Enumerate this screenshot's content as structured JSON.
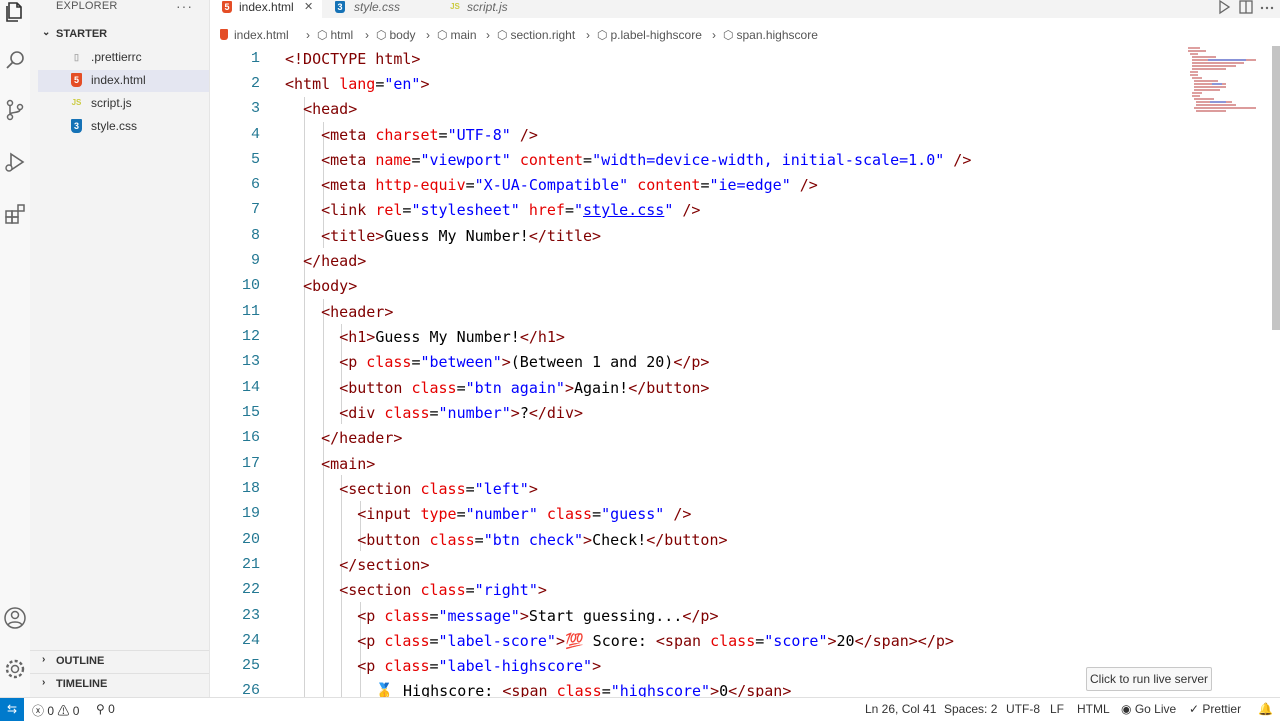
{
  "sidebar": {
    "title": "EXPLORER",
    "more": "···",
    "folder": "STARTER",
    "files": [
      {
        "name": ".prettierrc",
        "icon": "settings-file-icon"
      },
      {
        "name": "index.html",
        "icon": "html5-file-icon",
        "badge": "5"
      },
      {
        "name": "script.js",
        "icon": "javascript-file-icon",
        "badge": "JS"
      },
      {
        "name": "style.css",
        "icon": "css3-file-icon",
        "badge": "3"
      }
    ],
    "outline": "OUTLINE",
    "timeline": "TIMELINE"
  },
  "tabs": [
    {
      "label": "index.html",
      "active": true,
      "close": "✕",
      "badge": "5"
    },
    {
      "label": "style.css",
      "active": false,
      "badge": "3"
    },
    {
      "label": "script.js",
      "active": false,
      "badge": "JS"
    }
  ],
  "breadcrumb": [
    "index.html",
    "html",
    "body",
    "main",
    "section.right",
    "p.label-highscore",
    "span.highscore"
  ],
  "code": {
    "line_numbers": [
      "1",
      "2",
      "3",
      "4",
      "5",
      "6",
      "7",
      "8",
      "9",
      "10",
      "11",
      "12",
      "13",
      "14",
      "15",
      "16",
      "17",
      "18",
      "19",
      "20",
      "21",
      "22",
      "23",
      "24",
      "25",
      "26"
    ]
  },
  "status": {
    "errors": "0",
    "warnings": "0",
    "ports": "0",
    "position": "Ln 26, Col 41",
    "spaces": "Spaces: 2",
    "encoding": "UTF-8",
    "eol": "LF",
    "language": "HTML",
    "golive": "Go Live",
    "prettier": "Prettier"
  },
  "tooltip": "Click to run live server",
  "colors": {
    "accent": "#007acc",
    "html_icon": "#e44d26",
    "js_icon": "#cbcb41",
    "css_icon": "#1572b6"
  }
}
